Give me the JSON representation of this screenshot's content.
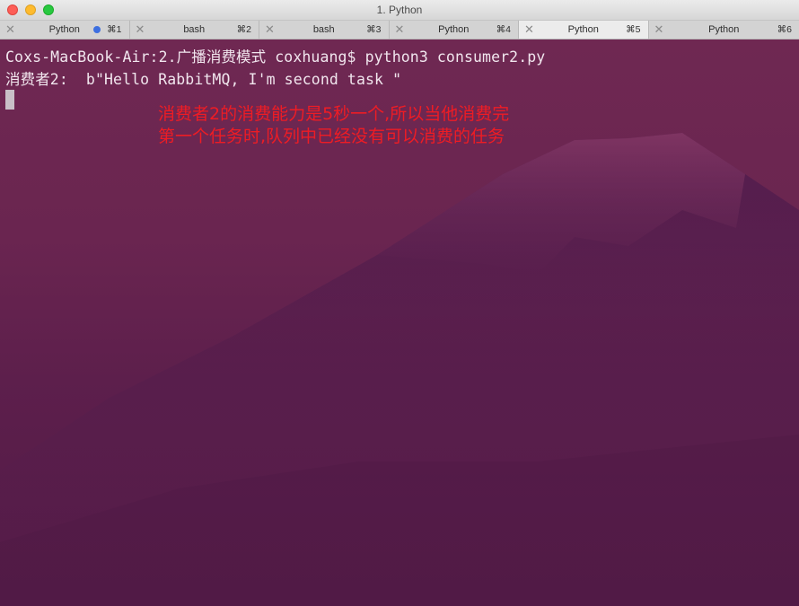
{
  "window": {
    "title": "1. Python"
  },
  "tabs": [
    {
      "label": "Python",
      "shortcut": "⌘1",
      "active": false,
      "activity_dot": true
    },
    {
      "label": "bash",
      "shortcut": "⌘2",
      "active": false
    },
    {
      "label": "bash",
      "shortcut": "⌘3",
      "active": false
    },
    {
      "label": "Python",
      "shortcut": "⌘4",
      "active": false
    },
    {
      "label": "Python",
      "shortcut": "⌘5",
      "active": true
    },
    {
      "label": "Python",
      "shortcut": "⌘6",
      "active": false
    }
  ],
  "terminal": {
    "lines": [
      "Coxs-MacBook-Air:2.广播消费模式 coxhuang$ python3 consumer2.py",
      "消费者2:  b\"Hello RabbitMQ, I'm second task \""
    ]
  },
  "annotation": {
    "lines": [
      "消费者2的消费能力是5秒一个,所以当他消费完",
      "第一个任务时,队列中已经没有可以消费的任务"
    ],
    "color": "#ee1c24"
  },
  "colors": {
    "background_top": "#6f2852",
    "background_bottom": "#521a46",
    "mountain": "#3c1744",
    "tab_activity_dot": "#3d6fe0"
  }
}
